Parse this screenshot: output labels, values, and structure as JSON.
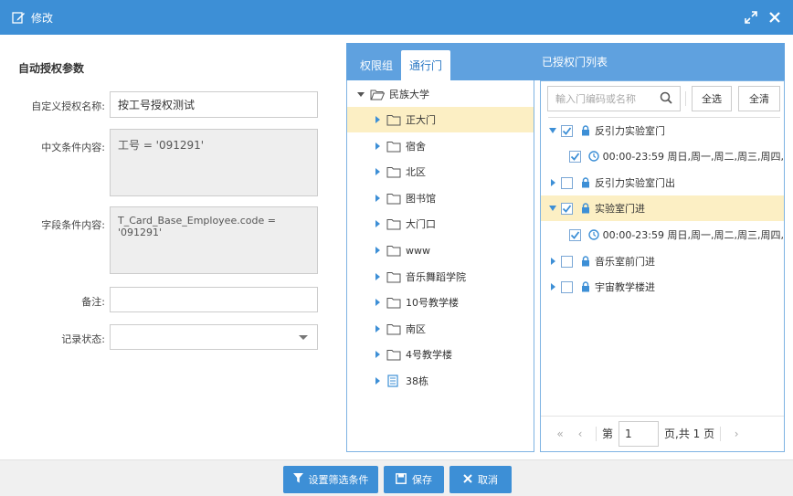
{
  "window": {
    "title": "修改",
    "icons": {
      "edit": "edit-icon",
      "maximize": "maximize-icon",
      "close": "close-icon"
    }
  },
  "form": {
    "section_title": "自动授权参数",
    "fields": {
      "name_label": "自定义授权名称:",
      "name_value": "按工号授权测试",
      "cn_condition_label": "中文条件内容:",
      "cn_condition_value": "工号 = '091291'",
      "field_condition_label": "字段条件内容:",
      "field_condition_value": "T_Card_Base_Employee.code = '091291'",
      "remark_label": "备注:",
      "remark_value": "",
      "status_label": "记录状态:",
      "status_value": ""
    }
  },
  "tabs": [
    {
      "label": "权限组",
      "active": false
    },
    {
      "label": "通行门",
      "active": true
    },
    {
      "label": "已授权门列表",
      "active": false
    }
  ],
  "tree": {
    "root": "民族大学",
    "items": [
      {
        "label": "正大门",
        "selected": true,
        "icon": "folder-icon"
      },
      {
        "label": "宿舍",
        "selected": false,
        "icon": "folder-icon"
      },
      {
        "label": "北区",
        "selected": false,
        "icon": "folder-icon"
      },
      {
        "label": "图书馆",
        "selected": false,
        "icon": "folder-icon"
      },
      {
        "label": "大门口",
        "selected": false,
        "icon": "folder-icon"
      },
      {
        "label": "www",
        "selected": false,
        "icon": "folder-icon"
      },
      {
        "label": "音乐舞蹈学院",
        "selected": false,
        "icon": "folder-icon"
      },
      {
        "label": "10号教学楼",
        "selected": false,
        "icon": "folder-icon"
      },
      {
        "label": "南区",
        "selected": false,
        "icon": "folder-icon"
      },
      {
        "label": "4号教学楼",
        "selected": false,
        "icon": "folder-icon"
      },
      {
        "label": "38栋",
        "selected": false,
        "icon": "building-icon"
      }
    ]
  },
  "doors": {
    "search_placeholder": "輸入门编码或名称",
    "select_all_label": "全选",
    "clear_label": "全清",
    "items": [
      {
        "label": "反引力实验室门",
        "checked": true,
        "expanded": true,
        "selected": false,
        "schedule": "00:00-23:59 周日,周一,周二,周三,周四,"
      },
      {
        "label": "反引力实验室门出",
        "checked": false,
        "expanded": false,
        "selected": false
      },
      {
        "label": "实验室门进",
        "checked": true,
        "expanded": true,
        "selected": true,
        "schedule": "00:00-23:59 周日,周一,周二,周三,周四,"
      },
      {
        "label": "音乐室前门进",
        "checked": false,
        "expanded": false,
        "selected": false
      },
      {
        "label": "宇宙教学楼进",
        "checked": false,
        "expanded": false,
        "selected": false
      }
    ]
  },
  "pager": {
    "prefix": "第",
    "page": "1",
    "suffix": "页,共 1 页"
  },
  "footer": {
    "filter_label": "设置筛选条件",
    "save_label": "保存",
    "cancel_label": "取消"
  },
  "colors": {
    "accent": "#3d8fd6",
    "tab_bar": "#5fa1df",
    "selected_row": "#fcefc4"
  }
}
